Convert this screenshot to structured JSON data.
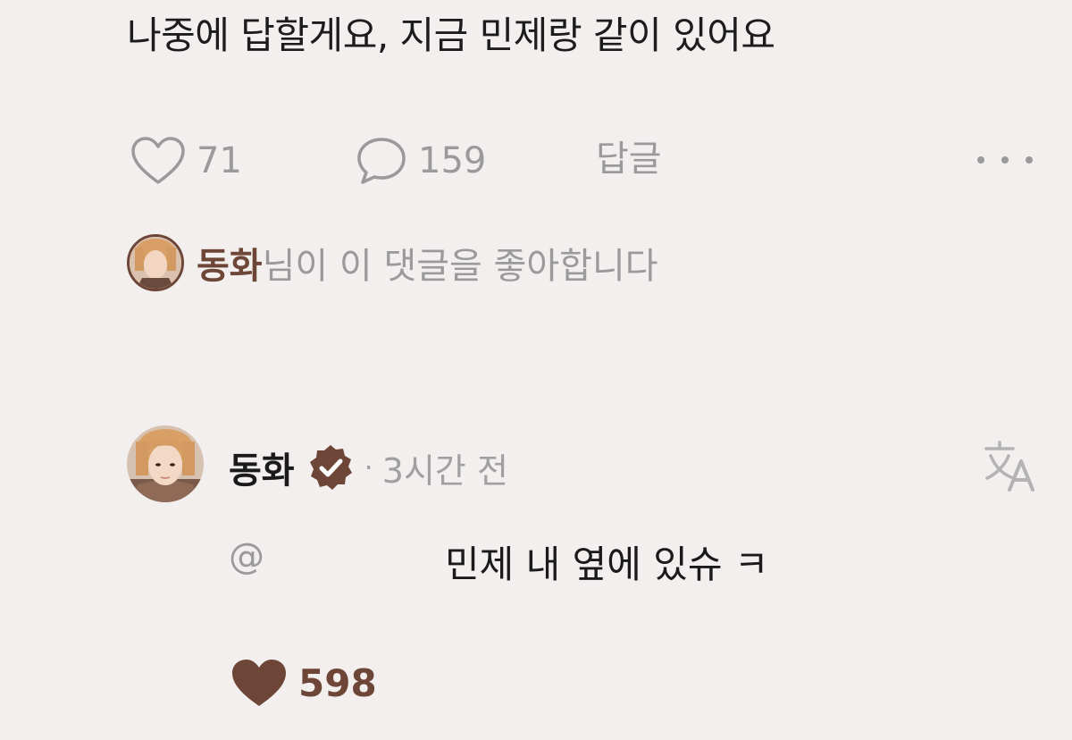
{
  "comment": {
    "text": "나중에 답할게요, 지금 민제랑 같이 있어요"
  },
  "actions": {
    "likes": "71",
    "replies": "159",
    "reply_label": "답글",
    "more_icon": "more-dots-icon"
  },
  "liked_by": {
    "name": "동화",
    "suffix": "님이 이 댓글을 좋아합니다"
  },
  "reply": {
    "author": "동화",
    "time": "3시간 전",
    "separator": "·",
    "mention": "@",
    "text": "민제 내 옆에 있슈 ㅋ",
    "likes": "598",
    "translate_icon": "translate-icon",
    "verified_icon": "verified-badge-icon"
  },
  "colors": {
    "background": "#f3efee",
    "accent": "#6e4638",
    "muted": "#9a9a9a"
  }
}
